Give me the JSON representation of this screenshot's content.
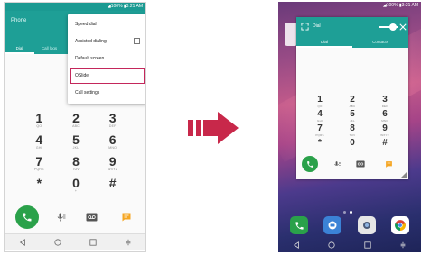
{
  "left_phone": {
    "status_text": "◢100% ▮3:21 AM",
    "title": "Phone",
    "tabs": [
      "Dial",
      "Call logs"
    ],
    "menu": {
      "items": [
        "Speed dial",
        "Assisted dialing",
        "Default screen",
        "QSlide",
        "Call settings"
      ],
      "highlighted": "QSlide"
    },
    "keypad": [
      {
        "digit": "1",
        "letters": "QO"
      },
      {
        "digit": "2",
        "letters": "ABC"
      },
      {
        "digit": "3",
        "letters": "DEF"
      },
      {
        "digit": "4",
        "letters": "GHI"
      },
      {
        "digit": "5",
        "letters": "JKL"
      },
      {
        "digit": "6",
        "letters": "MNO"
      },
      {
        "digit": "7",
        "letters": "PQRS"
      },
      {
        "digit": "8",
        "letters": "TUV"
      },
      {
        "digit": "9",
        "letters": "WXYZ"
      },
      {
        "digit": "*",
        "letters": ""
      },
      {
        "digit": "0",
        "letters": "+"
      },
      {
        "digit": "#",
        "letters": ""
      }
    ]
  },
  "right_phone": {
    "status_text": "◢100% ▮3:21 AM",
    "qslide_title": "Dial",
    "tabs": [
      "Dial",
      "Contacts"
    ],
    "keypad": [
      {
        "digit": "1",
        "letters": "QO"
      },
      {
        "digit": "2",
        "letters": "ABC"
      },
      {
        "digit": "3",
        "letters": "DEF"
      },
      {
        "digit": "4",
        "letters": "GHI"
      },
      {
        "digit": "5",
        "letters": "JKL"
      },
      {
        "digit": "6",
        "letters": "MNO"
      },
      {
        "digit": "7",
        "letters": "PQRS"
      },
      {
        "digit": "8",
        "letters": "TUV"
      },
      {
        "digit": "9",
        "letters": "WXYZ"
      },
      {
        "digit": "*",
        "letters": ""
      },
      {
        "digit": "0",
        "letters": "+"
      },
      {
        "digit": "#",
        "letters": ""
      }
    ],
    "dock_apps": [
      "phone-icon",
      "messages-icon",
      "camera-icon",
      "chrome-icon"
    ]
  },
  "colors": {
    "teal": "#1e9f96",
    "call_green": "#2aa14a",
    "highlight": "#c4275b",
    "arrow": "#c8284a",
    "message_orange": "#f5a623"
  }
}
